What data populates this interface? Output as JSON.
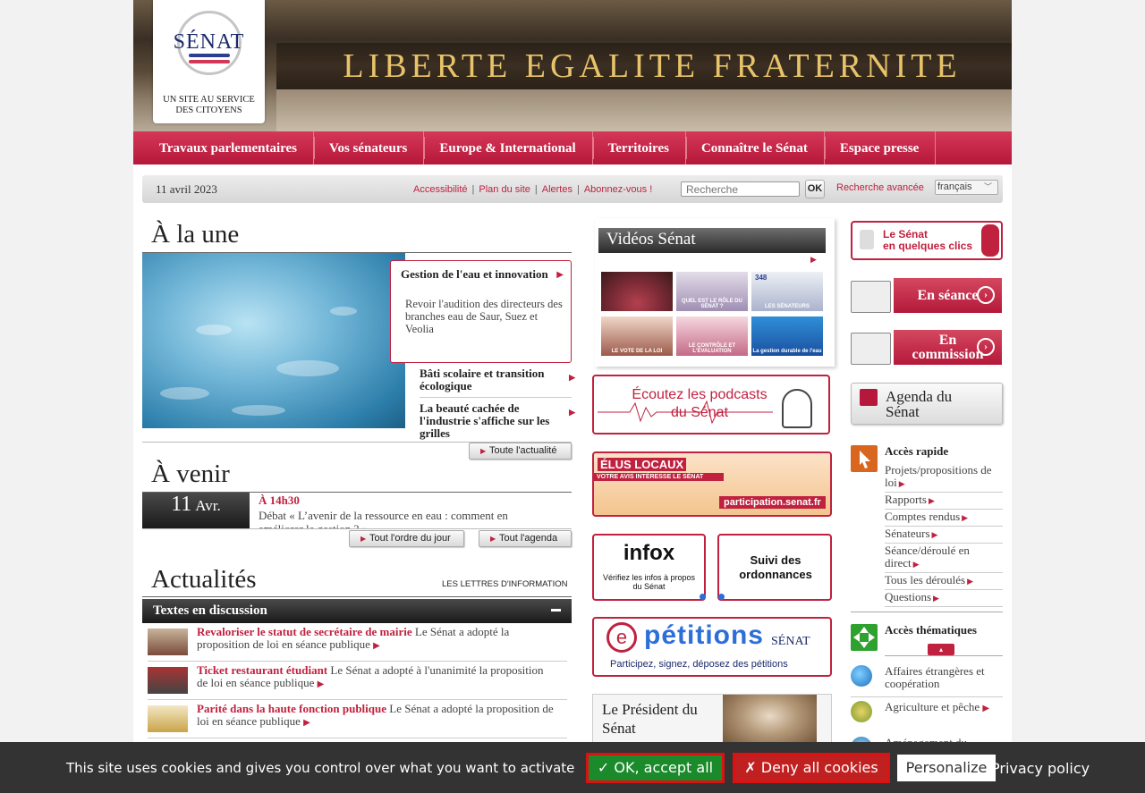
{
  "header": {
    "logo_name": "SÉNAT",
    "logo_tagline_1": "UN SITE AU SERVICE",
    "logo_tagline_2": "DES CITOYENS",
    "motto": "LIBERTE EGALITE FRATERNITE"
  },
  "nav": {
    "items": [
      "Travaux parlementaires",
      "Vos sénateurs",
      "Europe & International",
      "Territoires",
      "Connaître le Sénat",
      "Espace presse"
    ]
  },
  "toolbar": {
    "date": "11 avril 2023",
    "links": [
      "Accessibilité",
      "Plan du site",
      "Alertes",
      "Abonnez-vous !"
    ],
    "search_placeholder": "Recherche",
    "ok_label": "OK",
    "advanced": "Recherche avancée",
    "language": "français"
  },
  "une": {
    "title": "À la une",
    "feature_title": "Gestion de l'eau et innovation",
    "feature_desc": "Revoir l'audition des directeurs des branches eau de Saur, Suez et Veolia",
    "items": [
      "Bâti scolaire et transition écologique",
      "La beauté cachée de l'industrie s'affiche sur les grilles"
    ],
    "all_news": "Toute l'actualité"
  },
  "avenir": {
    "title": "À venir",
    "day": "11",
    "month": "Avr.",
    "hour": "À 14h30",
    "event": "Débat « L’avenir de la ressource en eau : comment en améliorer la gestion ? »",
    "btn_ordre": "Tout l'ordre du jour",
    "btn_agenda": "Tout l'agenda"
  },
  "actualites": {
    "title": "Actualités",
    "lettres": "LES LETTRES D'INFORMATION",
    "bar_title": "Textes en discussion",
    "rows": [
      {
        "title": "Revaloriser le statut de secrétaire de mairie",
        "desc": "Le Sénat a adopté la proposition de loi en séance publique"
      },
      {
        "title": "Ticket restaurant étudiant",
        "desc": "Le Sénat a adopté à l'unanimité la proposition de loi en séance publique"
      },
      {
        "title": "Parité dans la haute fonction publique",
        "desc": "Le Sénat a adopté la proposition de loi en séance publique"
      }
    ]
  },
  "videos": {
    "title": "Vidéos Sénat",
    "thumbs": [
      "",
      "QUEL EST LE RÔLE DU SÉNAT ?",
      "LES SÉNATEURS",
      "LE VOTE DE LA LOI",
      "LE CONTRÔLE ET L'ÉVALUATION",
      "La gestion durable de l'eau"
    ],
    "thumb_348": "348"
  },
  "promos": {
    "podcasts_1": "Écoutez les podcasts",
    "podcasts_2": "du Sénat",
    "elus_1": "ÉLUS LOCAUX",
    "elus_2": "VOTRE AVIS INTÉRESSE LE SÉNAT",
    "elus_3": "participation.senat.fr",
    "infox_1": "infox",
    "infox_2": "Vérifiez les infos à propos du Sénat",
    "suivi": "Suivi des ordonnances",
    "petitions_1": "pétitions",
    "petitions_2": "Participez, signez, déposez des pétitions",
    "petitions_logo": "SÉNAT",
    "president": "Le Président du Sénat"
  },
  "right": {
    "clics_1": "Le Sénat",
    "clics_2": "en quelques clics",
    "en_seance": "En séance",
    "en_commission_1": "En",
    "en_commission_2": "commission",
    "agenda_1": "Agenda du",
    "agenda_2": "Sénat",
    "acces_rapide_title": "Accès rapide",
    "acces_rapide": [
      "Projets/propositions de loi",
      "Rapports",
      "Comptes rendus",
      "Sénateurs",
      "Séance/déroulé en direct",
      "Tous les déroulés",
      "Questions"
    ],
    "acces_thematiques_title": "Accès thématiques",
    "themes": [
      "Affaires étrangères et coopération",
      "Agriculture et pêche",
      "Aménagement du territoire"
    ]
  },
  "cookie": {
    "message": "This site uses cookies and gives you control over what you want to activate",
    "accept": "✓ OK, accept all",
    "deny": "✗ Deny all cookies",
    "personalize": "Personalize",
    "privacy": "Privacy policy"
  },
  "colors": {
    "brand_red": "#b5183a",
    "nav_red": "#c0213f",
    "dark_bar": "#2a2a2a",
    "cookie_bg": "#333333"
  }
}
